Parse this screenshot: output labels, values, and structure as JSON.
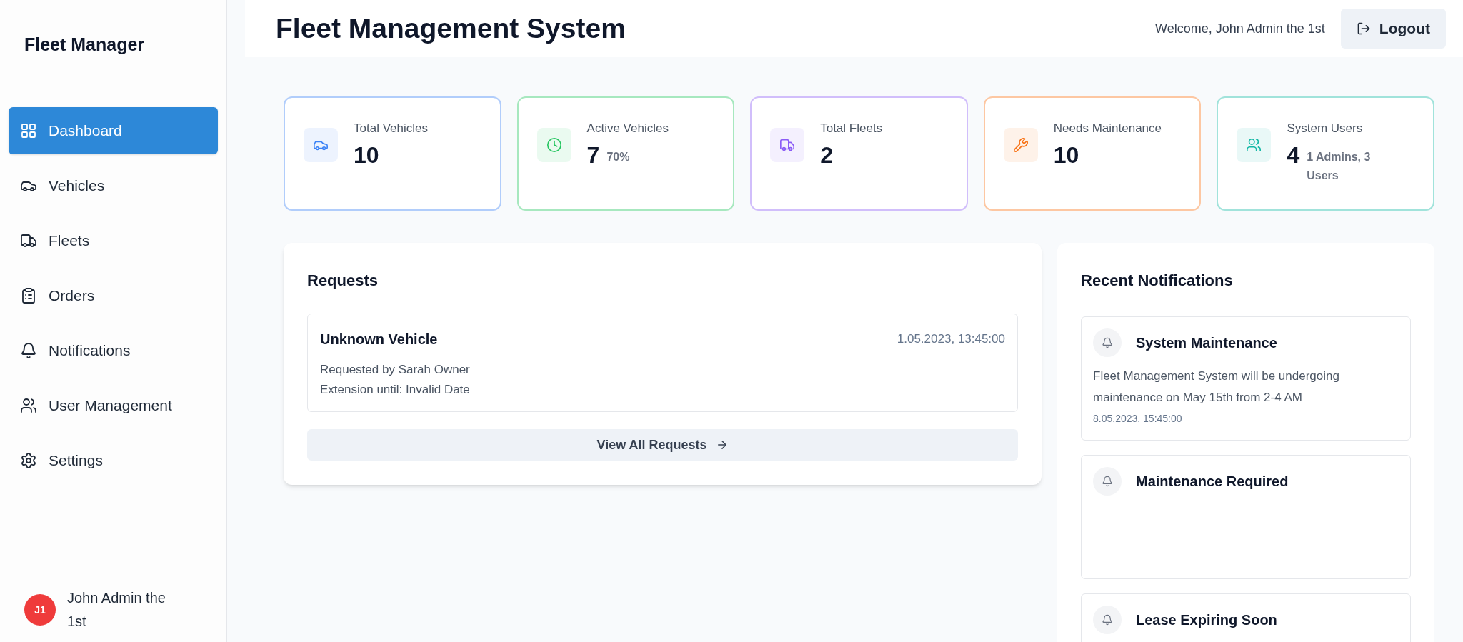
{
  "sidebar": {
    "title": "Fleet Manager",
    "items": [
      {
        "label": "Dashboard",
        "selected": true
      },
      {
        "label": "Vehicles",
        "selected": false
      },
      {
        "label": "Fleets",
        "selected": false
      },
      {
        "label": "Orders",
        "selected": false
      },
      {
        "label": "Notifications",
        "selected": false
      },
      {
        "label": "User Management",
        "selected": false
      },
      {
        "label": "Settings",
        "selected": false
      }
    ],
    "user": {
      "initials": "J1",
      "name": "John Admin the 1st"
    }
  },
  "header": {
    "title": "Fleet Management System",
    "welcome": "Welcome, John Admin the 1st",
    "logout": "Logout"
  },
  "stats": [
    {
      "label": "Total Vehicles",
      "value": "10",
      "color": "#3b82f6"
    },
    {
      "label": "Active Vehicles",
      "value": "7",
      "note": "70%",
      "color": "#22c55e"
    },
    {
      "label": "Total Fleets",
      "value": "2",
      "color": "#8b5cf6"
    },
    {
      "label": "Needs Maintenance",
      "value": "10",
      "color": "#f97316"
    },
    {
      "label": "System Users",
      "value": "4",
      "note": "1 Admins, 3 Users",
      "color": "#14b8a6"
    }
  ],
  "requests": {
    "title": "Requests",
    "items": [
      {
        "vehicle": "Unknown Vehicle",
        "time": "1.05.2023, 13:45:00",
        "requested_by": "Requested by Sarah Owner",
        "extension": "Extension until: Invalid Date"
      }
    ],
    "view_all": "View All Requests"
  },
  "notifications": {
    "title": "Recent Notifications",
    "items": [
      {
        "title": "System Maintenance",
        "message": "Fleet Management System will be undergoing maintenance on May 15th from 2-4 AM",
        "time": "8.05.2023, 15:45:00"
      },
      {
        "title": "Maintenance Required"
      },
      {
        "title": "Lease Expiring Soon"
      }
    ]
  }
}
